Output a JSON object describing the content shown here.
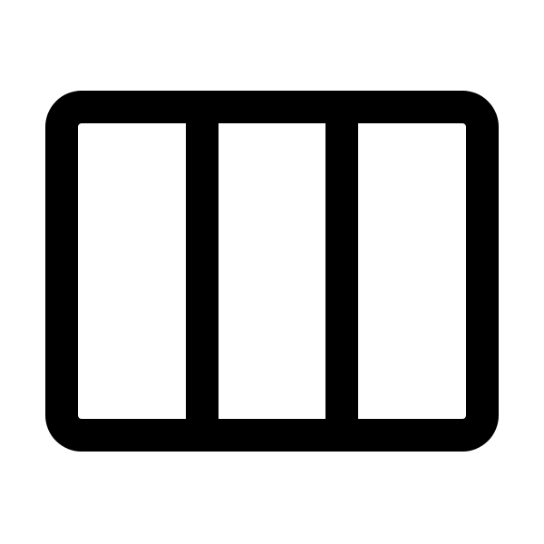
{
  "icon": {
    "name": "view-column-icon",
    "stroke_color": "#000000",
    "background_color": "#ffffff"
  }
}
